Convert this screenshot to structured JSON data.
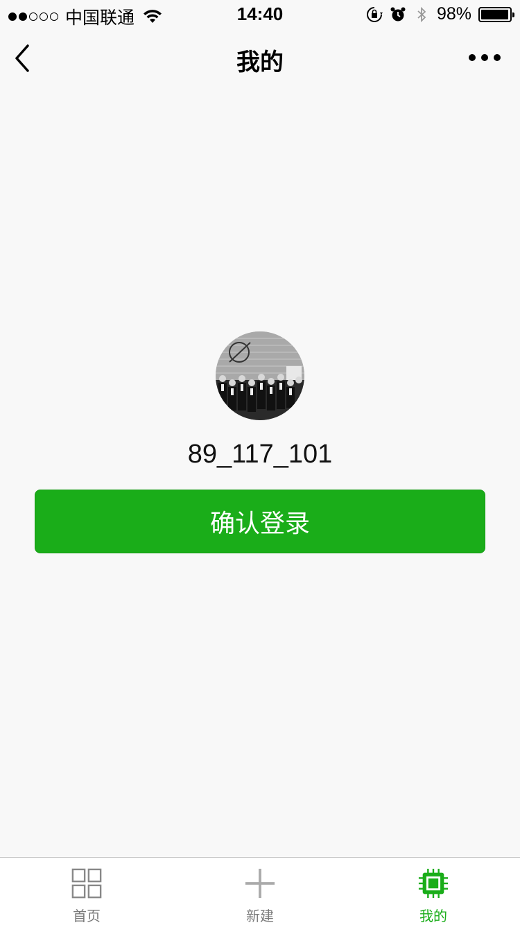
{
  "status_bar": {
    "carrier": "中国联通",
    "time": "14:40",
    "battery_percent": "98%",
    "battery_level": 0.98,
    "signal_bars_filled": 2,
    "signal_bars_total": 5
  },
  "nav": {
    "title": "我的",
    "back_icon": "chevron-left-icon",
    "more_icon": "more-dots-icon"
  },
  "profile": {
    "username": "89_117_101"
  },
  "actions": {
    "confirm_login_label": "确认登录"
  },
  "tab_bar": {
    "items": [
      {
        "label": "首页",
        "icon": "grid-icon",
        "active": false
      },
      {
        "label": "新建",
        "icon": "plus-icon",
        "active": false
      },
      {
        "label": "我的",
        "icon": "chip-icon",
        "active": true
      }
    ]
  },
  "colors": {
    "accent": "#1aad19",
    "background": "#f8f8f8",
    "tab_inactive": "#7a7a7a"
  }
}
